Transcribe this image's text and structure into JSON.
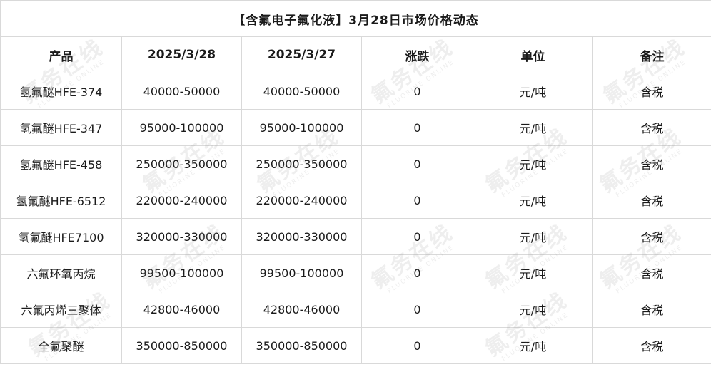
{
  "title": "【含氟电子氟化液】3月28日市场价格动态",
  "headers": [
    "产品",
    "2025/3/28",
    "2025/3/27",
    "涨跌",
    "单位",
    "备注"
  ],
  "rows": [
    {
      "product": "氢氟醚HFE-374",
      "price_0328": "40000-50000",
      "price_0327": "40000-50000",
      "change": "0",
      "unit": "元/吨",
      "note": "含税"
    },
    {
      "product": "氢氟醚HFE-347",
      "price_0328": "95000-100000",
      "price_0327": "95000-100000",
      "change": "0",
      "unit": "元/吨",
      "note": "含税"
    },
    {
      "product": "氢氟醚HFE-458",
      "price_0328": "250000-350000",
      "price_0327": "250000-350000",
      "change": "0",
      "unit": "元/吨",
      "note": "含税"
    },
    {
      "product": "氢氟醚HFE-6512",
      "price_0328": "220000-240000",
      "price_0327": "220000-240000",
      "change": "0",
      "unit": "元/吨",
      "note": "含税"
    },
    {
      "product": "氢氟醚HFE7100",
      "price_0328": "320000-330000",
      "price_0327": "320000-330000",
      "change": "0",
      "unit": "元/吨",
      "note": "含税"
    },
    {
      "product": "六氟环氧丙烷",
      "price_0328": "99500-100000",
      "price_0327": "99500-100000",
      "change": "0",
      "unit": "元/吨",
      "note": "含税"
    },
    {
      "product": "六氟丙烯三聚体",
      "price_0328": "42800-46000",
      "price_0327": "42800-46000",
      "change": "0",
      "unit": "元/吨",
      "note": "含税"
    },
    {
      "product": "全氟聚醚",
      "price_0328": "350000-850000",
      "price_0327": "350000-850000",
      "change": "0",
      "unit": "元/吨",
      "note": "含税"
    }
  ],
  "watermark": {
    "cn": "氟务在线",
    "en": "FLUORINE ONLINE"
  }
}
